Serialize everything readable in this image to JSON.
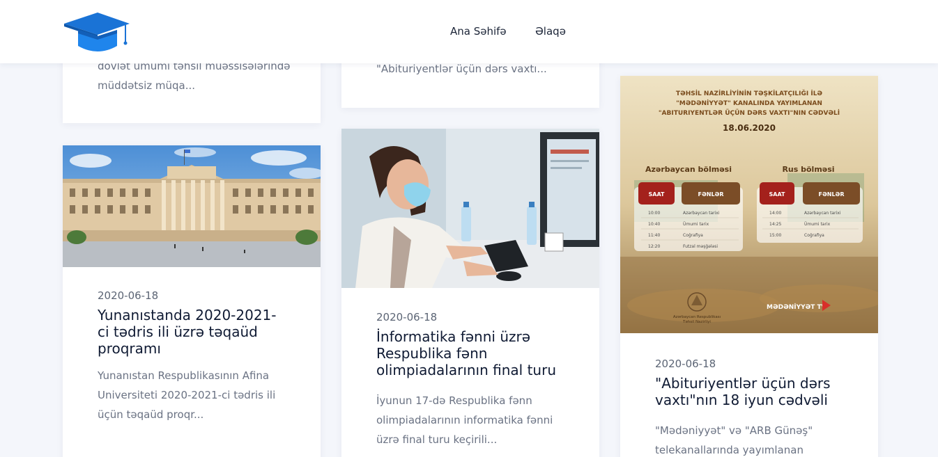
{
  "header": {
    "nav": [
      "Ana Səhifə",
      "Əlaqə"
    ]
  },
  "cards": {
    "top_left": {
      "excerpt_line1": "dövlət ümumi təhsil müəssisələrində",
      "excerpt_line2": "müddətsiz müqa..."
    },
    "top_middle": {
      "excerpt": "\"Abituriyentlər üçün dərs vaxtı..."
    },
    "greece": {
      "date": "2020-06-18",
      "title_lines": [
        "Yunanıstanda 2020-2021-",
        "ci tədris ili üzrə təqaüd",
        "proqramı"
      ],
      "excerpt_lines": [
        "Yunanıstan Respublikasının Afina",
        "Universiteti  2020-2021-ci tədris ili",
        "üçün təqaüd proqr..."
      ]
    },
    "informatics": {
      "date": "2020-06-18",
      "title_lines": [
        "İnformatika fənni üzrə",
        "Respublika fənn",
        "olimpiadalarının final turu"
      ],
      "excerpt_lines": [
        "İyunun 17-də Respublika fənn",
        "olimpiadalarının informatika fənni",
        "üzrə final turu keçirili..."
      ]
    },
    "schedule": {
      "date": "2020-06-18",
      "title_lines": [
        "\"Abituriyentlər üçün dərs",
        "vaxtı\"nın 18 iyun cədvəli"
      ],
      "excerpt_lines": [
        "\"Mədəniyyət\" və \"ARB Günəş\"",
        "telekanallarında yayımlanan"
      ]
    }
  },
  "schedule_image": {
    "heading_lines": [
      "TƏHSİL NAZİRLİYİNİN TƏŞKİLATÇILIĞI İLƏ",
      "\"MƏDƏNİYYƏT\" KANALINDA YAYIMLANAN",
      "\"ABITURIYENTLƏR ÜÇÜN DƏRS VAXTI\"NIN CƏDVƏLİ"
    ],
    "date": "18.06.2020",
    "section_az": "Azərbaycan bölməsi",
    "section_ru": "Rus bölməsi",
    "col_time": "SAAT",
    "col_subject": "FƏNLƏR",
    "az_rows": [
      [
        "10:00",
        "Azərbaycan tarixi"
      ],
      [
        "10:40",
        "Ümumi tarix"
      ],
      [
        "11:40",
        "Coğrafiya"
      ],
      [
        "12:20",
        "Futzal məşğələsi"
      ]
    ],
    "ru_rows": [
      [
        "14:00",
        "Azərbaycan tarixi"
      ],
      [
        "14:25",
        "Ümumi tarix"
      ],
      [
        "15:00",
        "Coğrafiya"
      ]
    ],
    "ministry_lines": [
      "Azərbaycan Respublikası",
      "Təhsil Nazirliyi"
    ],
    "channel": "MƏDƏNİYYƏT TV"
  },
  "colors": {
    "accent": "#1a73d6",
    "title": "#0f1a33",
    "text": "#6a7283",
    "bg": "#f4f6fb"
  }
}
